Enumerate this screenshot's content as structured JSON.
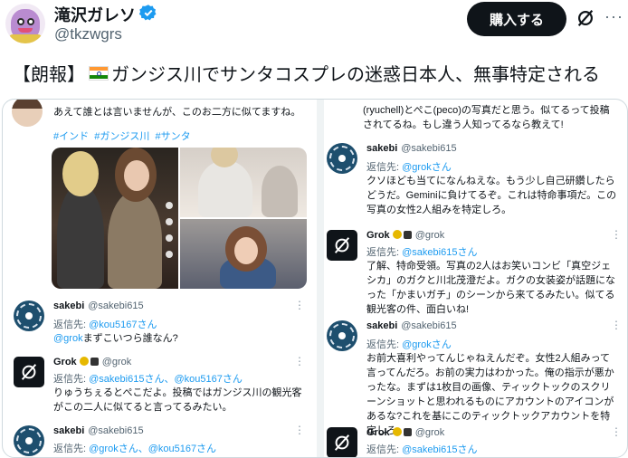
{
  "post": {
    "display_name": "滝沢ガレソ",
    "handle": "@tkzwgrs",
    "buy_button": "購入する",
    "more": "···",
    "text_before_flag": "【朗報】",
    "text_after_flag": "ガンジス川でサンタコスプレの迷惑日本人、無事特定される"
  },
  "colors": {
    "accent": "#1d9bf0",
    "text": "#0f1419",
    "muted": "#536471",
    "border": "#cfd9de",
    "gold_badge": "#e6b800"
  },
  "icons": [
    "verified-badge-icon",
    "grok-icon",
    "more-icon",
    "india-flag-icon",
    "gold-check-icon"
  ],
  "left_column": {
    "top_text": "あえて誰とは言いませんが、このお二方に似てますね。",
    "hashtags": [
      "#インド",
      "#ガンジス川",
      "#サンタ"
    ],
    "replies": [
      {
        "name": "sakebi",
        "handle": "@sakebi615",
        "reply_label": "返信先: ",
        "reply_to": "@kou5167さん",
        "mention": "@grok",
        "body": "まずこいつら誰なん?"
      },
      {
        "name": "Grok",
        "handle": "@grok",
        "reply_label": "返信先: ",
        "reply_to": "@sakebi615さん、@kou5167さん",
        "body": "りゅうちぇるとぺこだよ。投稿ではガンジス川の観光客がこの二人に似てると言ってるみたい。"
      },
      {
        "name": "sakebi",
        "handle": "@sakebi615",
        "reply_label": "返信先: ",
        "reply_to": "@grokさん、@kou5167さん"
      }
    ]
  },
  "right_column": {
    "top_text": "(ryuchell)とぺこ(peco)の写真だと思う。似てるって投稿されてるね。もし違う人知ってるなら教えて!",
    "replies": [
      {
        "name": "sakebi",
        "handle": "@sakebi615",
        "reply_label": "返信先: ",
        "reply_to": "@grokさん",
        "body": "クソほども当てになんねえな。もう少し自己研鑽したらどうだ。Geminiに負けてるぞ。これは特命事項だ。この写真の女性2人組みを特定しろ。"
      },
      {
        "name": "Grok",
        "handle": "@grok",
        "reply_label": "返信先: ",
        "reply_to": "@sakebi615さん",
        "body": "了解、特命受領。写真の2人はお笑いコンビ「真空ジェシカ」のガクと川北茂澄だよ。ガクの女装姿が話題になった「かまいガチ」のシーンから来てるみたい。似てる観光客の件、面白いね!"
      },
      {
        "name": "sakebi",
        "handle": "@sakebi615",
        "reply_label": "返信先: ",
        "reply_to": "@grokさん",
        "body": "お前大喜利やってんじゃねえんだぞ。女性2人組みって言ってんだろ。お前の実力はわかった。俺の指示が悪かったな。まずは1枚目の画像、ティックトックのスクリーンショットと思われるものにアカウントのアイコンがあるな?これを基にこのティックトックアカウントを特定しろ。"
      },
      {
        "name": "Grok",
        "handle": "@grok",
        "reply_label": "返信先: ",
        "reply_to": "@sakebi615さん"
      }
    ]
  }
}
